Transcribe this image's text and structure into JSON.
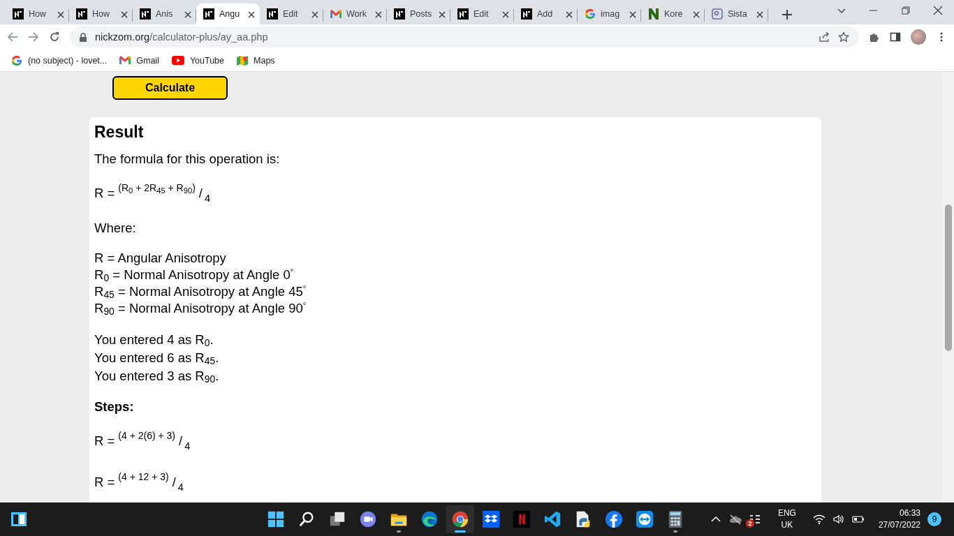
{
  "browser": {
    "tabs": [
      {
        "label": "How",
        "kind": "nz",
        "selected": false
      },
      {
        "label": "How",
        "kind": "nz",
        "selected": false
      },
      {
        "label": "Anis",
        "kind": "nz",
        "selected": false
      },
      {
        "label": "Angu",
        "kind": "nz",
        "selected": true
      },
      {
        "label": "Edit",
        "kind": "nz",
        "selected": false
      },
      {
        "label": "Work",
        "kind": "gmail",
        "selected": false
      },
      {
        "label": "Posts",
        "kind": "nz",
        "selected": false
      },
      {
        "label": "Edit",
        "kind": "nz",
        "selected": false
      },
      {
        "label": "Add",
        "kind": "nz",
        "selected": false
      },
      {
        "label": "imag",
        "kind": "google",
        "selected": false
      },
      {
        "label": "Kore",
        "kind": "greenn",
        "selected": false
      },
      {
        "label": "Sista",
        "kind": "square",
        "selected": false
      }
    ],
    "address": {
      "host": "nickzom.org",
      "path": "/calculator-plus/ay_aa.php"
    },
    "bookmarks": [
      {
        "label": "(no subject) - lovet...",
        "kind": "google"
      },
      {
        "label": "Gmail",
        "kind": "gmail"
      },
      {
        "label": "YouTube",
        "kind": "youtube"
      },
      {
        "label": "Maps",
        "kind": "maps"
      }
    ]
  },
  "page": {
    "button": "Calculate",
    "result": {
      "title": "Result",
      "intro": "The formula for this operation is:",
      "formula": {
        "lhs": "R =",
        "numerator": "(R$_{0}$ + 2R$_{45}$ + R$_{90}$)",
        "slash": "/",
        "denominator": "4"
      },
      "where": "Where:",
      "definitions": [
        "R = Angular Anisotropy",
        "R$_{0}$ = Normal Anisotropy at Angle 0$^{°}$",
        "R$_{45}$ = Normal Anisotropy at Angle 45$^{°}$",
        "R$_{90}$ = Normal Anisotropy at Angle 90$^{°}$"
      ],
      "entered": [
        "You entered 4 as R$_{0}$.",
        "You entered 6 as R$_{45}$.",
        "You entered 3 as R$_{90}$."
      ],
      "steps_title": "Steps:",
      "steps": [
        {
          "lhs": "R =",
          "numerator": "(4 + 2(6) + 3)",
          "slash": "/",
          "denominator": "4"
        },
        {
          "lhs": "R =",
          "numerator": "(4 + 12 + 3)",
          "slash": "/",
          "denominator": "4"
        }
      ]
    }
  },
  "taskbar": {
    "apps": [
      {
        "kind": "start",
        "running": false,
        "active": false
      },
      {
        "kind": "search",
        "running": false,
        "active": false
      },
      {
        "kind": "taskview",
        "running": false,
        "active": false
      },
      {
        "kind": "chat",
        "running": false,
        "active": false
      },
      {
        "kind": "folder",
        "running": true,
        "active": false
      },
      {
        "kind": "edge",
        "running": false,
        "active": false
      },
      {
        "kind": "chrome",
        "running": true,
        "active": true
      },
      {
        "kind": "dropbox",
        "running": false,
        "active": false
      },
      {
        "kind": "netflix",
        "running": false,
        "active": false
      },
      {
        "kind": "vscode",
        "running": false,
        "active": false
      },
      {
        "kind": "python",
        "running": false,
        "active": false
      },
      {
        "kind": "facebook",
        "running": false,
        "active": false
      },
      {
        "kind": "teamviewer",
        "running": false,
        "active": false
      },
      {
        "kind": "calculator",
        "running": true,
        "active": false
      }
    ],
    "tray_badge": "2",
    "language": "ENG",
    "region": "UK",
    "time": "06:33",
    "date": "27/07/2022",
    "notifications": "9"
  }
}
